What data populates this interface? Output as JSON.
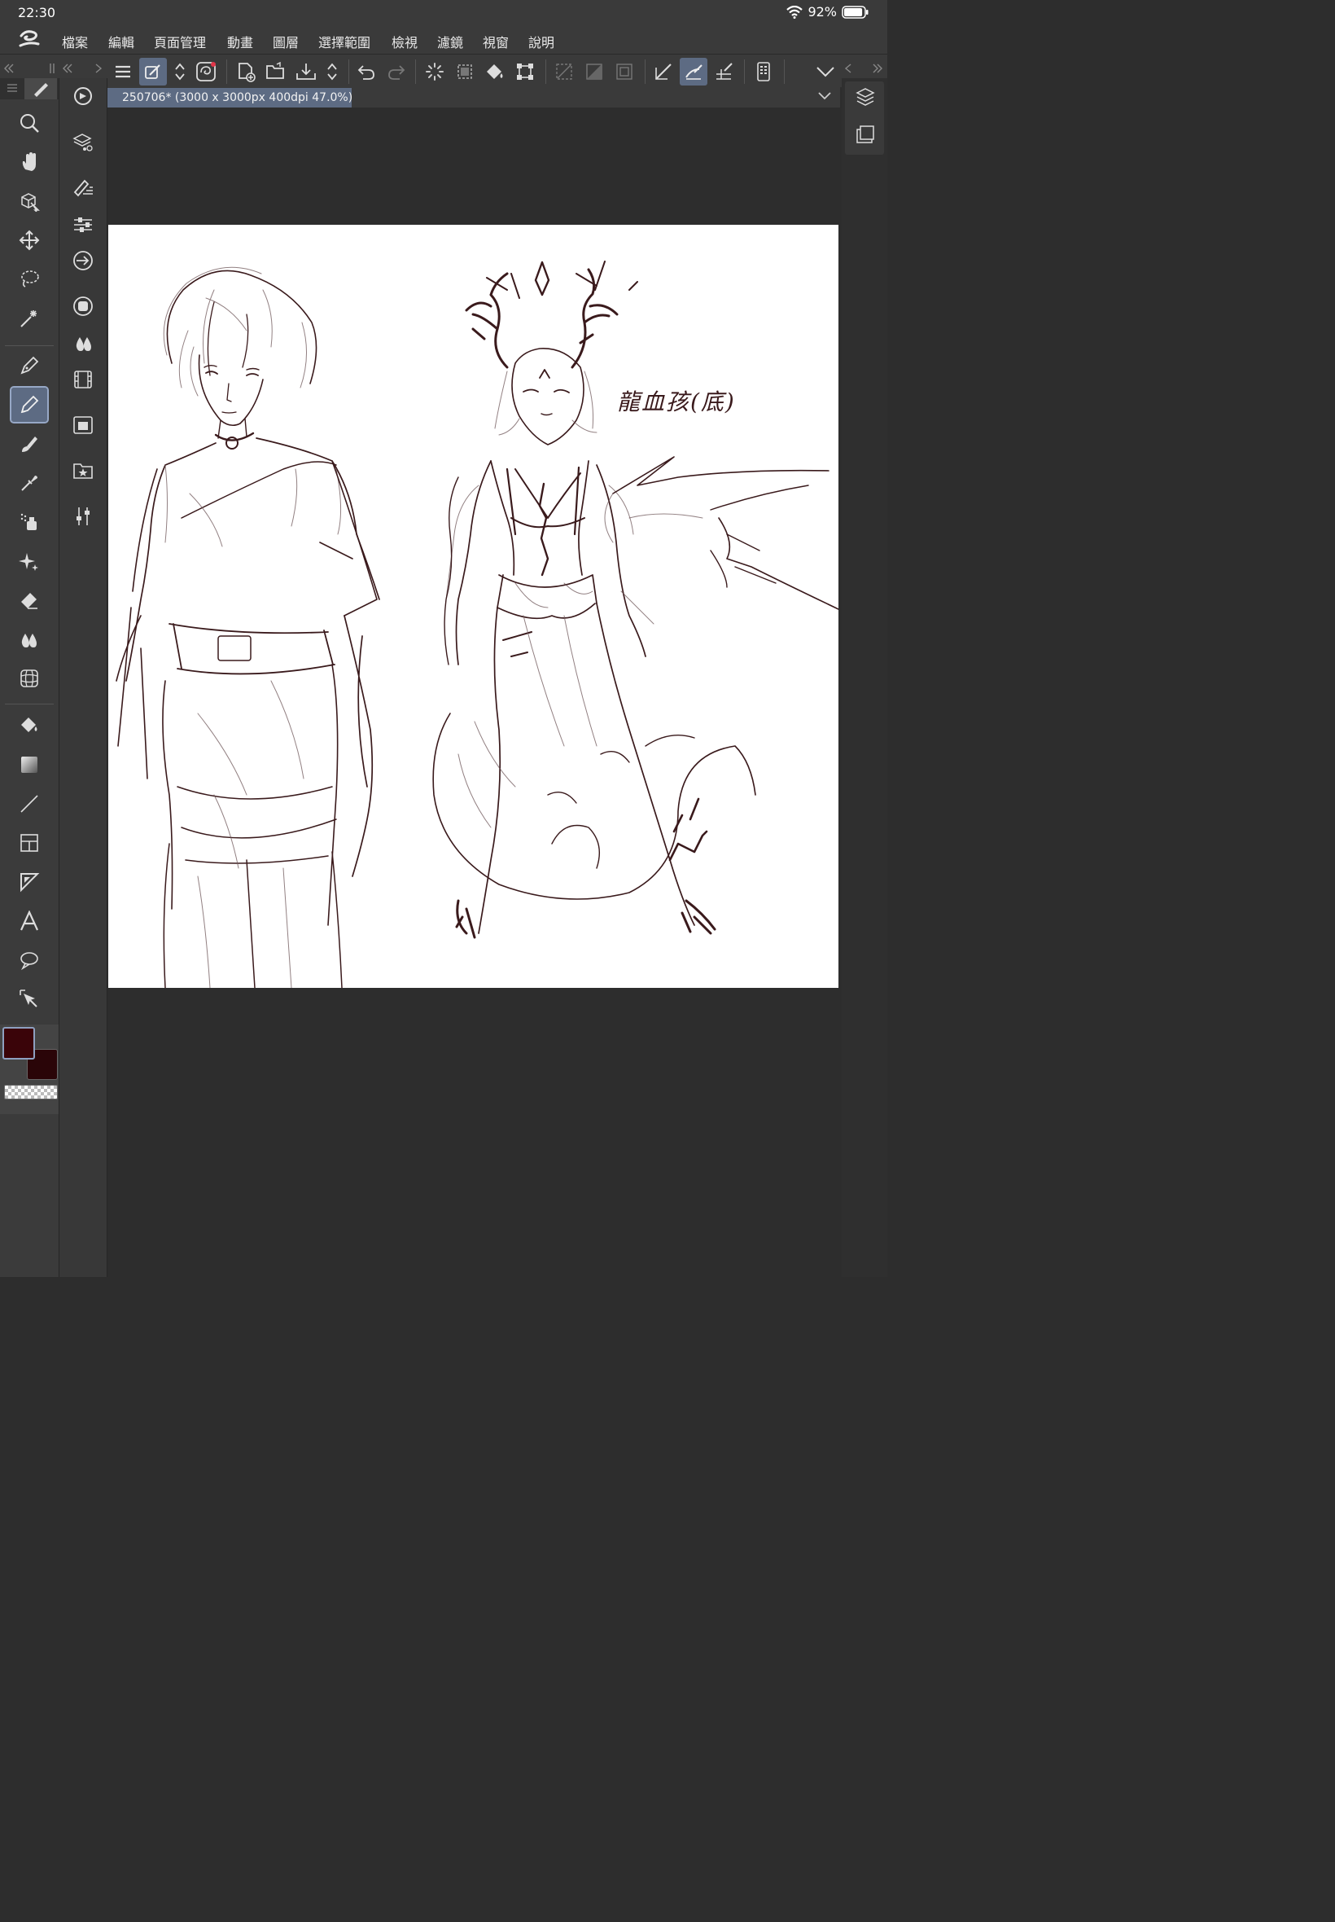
{
  "status": {
    "time": "22:30",
    "battery": "92%",
    "battery_level": 0.92,
    "icons": [
      "wifi-icon",
      "battery-icon"
    ]
  },
  "app": {
    "logo": "clip-studio-logo"
  },
  "menu": {
    "items": [
      "檔案",
      "編輯",
      "頁面管理",
      "動畫",
      "圖層",
      "選擇範圍",
      "檢視",
      "濾鏡",
      "視窗",
      "說明"
    ]
  },
  "document": {
    "tab_label": "250706* (3000 x 3000px 400dpi 47.0%)"
  },
  "canvas": {
    "note": "龍血孩(底)"
  },
  "toolbar": {
    "icons": [
      "menu-icon",
      "quick-access-icon",
      "expand-icon",
      "clip-studio-icon",
      "new-icon",
      "open-icon",
      "save-icon",
      "expand-icon",
      "undo-icon",
      "redo-icon",
      "loading-icon",
      "select-all-icon",
      "fill-icon",
      "transform-icon",
      "clear-selection-icon",
      "invert-selection-icon",
      "selection-border-icon",
      "ruler-snap-icon",
      "special-ruler-snap-icon",
      "grid-snap-icon",
      "device-icon",
      "collapse-icon"
    ],
    "active": [
      "quick-access-icon",
      "special-ruler-snap-icon"
    ]
  },
  "tools": {
    "items": [
      "zoom-icon",
      "hand-icon",
      "3d-object-icon",
      "move-icon",
      "lasso-icon",
      "magic-wand-icon",
      "pen-icon",
      "pencil-icon",
      "brush-icon",
      "eyedropper-icon",
      "airbrush-icon",
      "decoration-icon",
      "eraser-icon",
      "blend-icon",
      "liquify-icon",
      "fill-icon",
      "gradient-icon",
      "line-icon",
      "frame-icon",
      "ruler-icon",
      "text-icon",
      "balloon-icon",
      "operation-icon"
    ],
    "active": "pencil-icon"
  },
  "subtools": {
    "items": [
      "rotate-view-icon",
      "layer-property-icon",
      "brush-size-icon",
      "tool-property-icon",
      "color-circle-icon",
      "color-set-icon",
      "layer-search-icon",
      "animation-icon",
      "navigator-icon",
      "material-icon",
      "adjust-icon"
    ]
  },
  "colors": {
    "main": "#3a0409",
    "sub": "#2a0508",
    "accent": "#5d6b83"
  }
}
